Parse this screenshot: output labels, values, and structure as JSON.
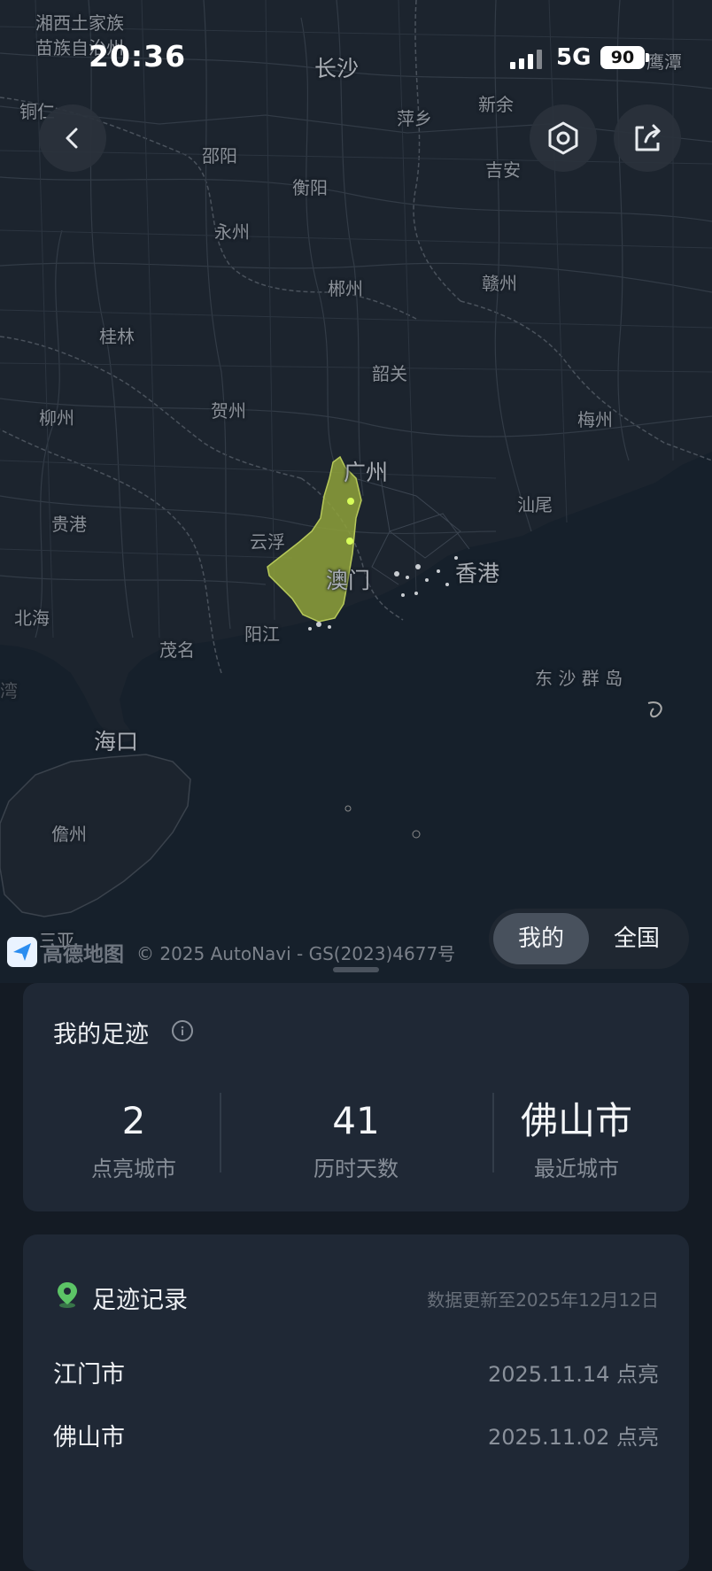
{
  "status_bar": {
    "time": "20:36",
    "network": "5G",
    "battery": "90"
  },
  "map": {
    "labels": {
      "xiangxi": "湘西土家族",
      "miaozu": "苗族自治州",
      "changsha": "长沙",
      "yingtan": "鹰潭",
      "tongren": "铜仁",
      "pingxiang": "萍乡",
      "xinyu": "新余",
      "shaoyang": "邵阳",
      "hengyang": "衡阳",
      "ji_an": "吉安",
      "yongzhou": "永州",
      "chenzhou": "郴州",
      "ganzhou": "赣州",
      "guilin": "桂林",
      "shaoguan": "韶关",
      "liuzhou": "柳州",
      "hezhou": "贺州",
      "meizhou": "梅州",
      "guangzhou": "广州",
      "guigang": "贵港",
      "yunfu": "云浮",
      "shanwei": "汕尾",
      "macau": "澳门",
      "hongkong": "香港",
      "beihai": "北海",
      "yangjiang": "阳江",
      "maoming": "茂名",
      "dongsha": "东 沙 群 岛",
      "wan": "湾",
      "haikou": "海口",
      "danzhou": "儋州",
      "sanya": "三亚"
    },
    "colors": {
      "highlight": "#8ea13a",
      "highlight_stroke": "#b7c95a",
      "dot": "#d8ff5a"
    }
  },
  "toolbar": {
    "back": "back",
    "settings": "settings",
    "share": "share"
  },
  "attribution": {
    "logo": "高德地图",
    "copyright": "© 2025 AutoNavi - GS(2023)4677号"
  },
  "toggle": {
    "mine": "我的",
    "national": "全国"
  },
  "summary": {
    "title": "我的足迹",
    "stats": [
      {
        "value": "2",
        "label": "点亮城市"
      },
      {
        "value": "41",
        "label": "历时天数"
      },
      {
        "value": "佛山市",
        "label": "最近城市"
      }
    ]
  },
  "records": {
    "title": "足迹记录",
    "updated": "数据更新至2025年12月12日",
    "items": [
      {
        "city": "江门市",
        "date": "2025.11.14 点亮"
      },
      {
        "city": "佛山市",
        "date": "2025.11.02 点亮"
      }
    ]
  }
}
